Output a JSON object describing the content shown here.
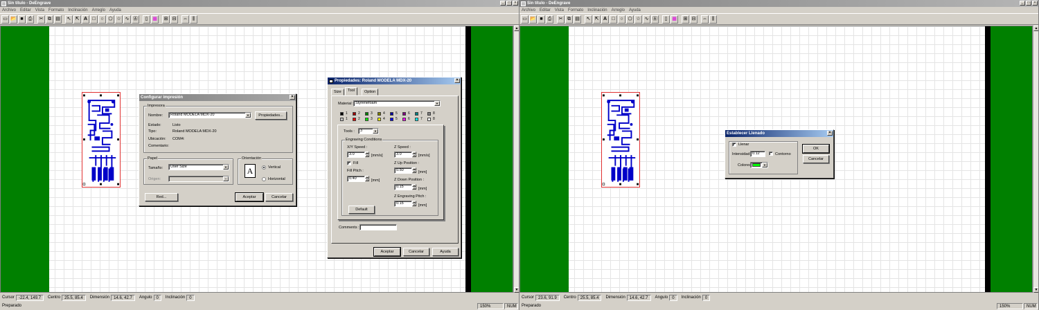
{
  "app": {
    "title": "Sin título - DeEngrave",
    "menu": [
      "Archivo",
      "Editar",
      "Vista",
      "Formato",
      "Inclinación",
      "Arreglo",
      "Ayuda"
    ],
    "toolbar_icons": [
      "new-icon",
      "open-icon",
      "save-icon",
      "print-icon",
      "cut-icon",
      "copy-icon",
      "paste-icon",
      "select-arrow-icon",
      "node-edit-icon",
      "text-tool-icon",
      "rectangle-tool-icon",
      "ellipse-tool-icon",
      "polygon-tool-icon",
      "star-tool-icon",
      "curve-tool-icon",
      "text-frame-icon",
      "fill-icon",
      "color-icon",
      "ungroup-icon",
      "group-icon",
      "size-icon",
      "align-icon"
    ],
    "window_buttons": [
      "_",
      "□",
      "×"
    ]
  },
  "left": {
    "status": {
      "cursor_label": "Cursor",
      "cursor": "-22.4, 149.7",
      "center_label": "Centro",
      "center": "25.5, 85.4",
      "dimension_label": "Dimensión",
      "dimension": "14.6, 42.7",
      "angle_label": "Angulo",
      "angle": "0",
      "inclination_label": "Inclinación",
      "inclination": "0"
    },
    "footer": {
      "ready": "Preparado",
      "zoom": "150%",
      "num": "NUM"
    }
  },
  "right": {
    "status": {
      "cursor_label": "Cursor",
      "cursor": "23.6, 91.9",
      "center_label": "Centro",
      "center": "25.5, 85.4",
      "dimension_label": "Dimensión",
      "dimension": "14.6, 42.7",
      "angle_label": "Angulo",
      "angle": "0",
      "inclination_label": "Inclinación",
      "inclination": "0"
    },
    "footer": {
      "ready": "Preparado",
      "zoom": "150%",
      "num": "NUM"
    }
  },
  "print_dialog": {
    "title": "Configurar impresión",
    "printer_group": "Impresora",
    "name_label": "Nombre:",
    "name_value": "Roland MODELA MDX-20",
    "properties_button": "Propiedades...",
    "status_label": "Estado:",
    "status_value": "Listo",
    "type_label": "Tipo:",
    "type_value": "Roland MODELA MDX-20",
    "location_label": "Ubicación:",
    "location_value": "COM4:",
    "comment_label": "Comentario:",
    "paper_group": "Papel",
    "size_label": "Tamaño:",
    "size_value": "User Size",
    "source_label": "Origen:",
    "orientation_group": "Orientación",
    "orientation_icon_letter": "A",
    "vertical_label": "Vertical",
    "horizontal_label": "Horizontal",
    "network_button": "Red...",
    "accept_button": "Aceptar",
    "cancel_button": "Cancelar"
  },
  "props_dialog": {
    "title": "Propiedades: Roland MODELA MDX-20",
    "tabs": [
      "Size",
      "Tool",
      "Option"
    ],
    "material_label": "Material :",
    "material_value": "Styrenefoam",
    "tool_numbers": [
      "1",
      "2",
      "3",
      "4",
      "5",
      "6",
      "7",
      "8"
    ],
    "tool_colors_top": [
      "#000000",
      "#a00000",
      "#008000",
      "#808000",
      "#0000a0",
      "#800080",
      "#008080",
      "#808080"
    ],
    "tool_colors_bottom": [
      "#c0c0c0",
      "#ff0000",
      "#00ff00",
      "#ffff00",
      "#0000ff",
      "#ff00ff",
      "#00ffff",
      "#ffffff"
    ],
    "tools_label": "Tools :",
    "tools_value": "3",
    "engraving_group": "Engraving Conditions",
    "xy_speed_label": "X/Y Speed :",
    "xy_speed_value": "3.0",
    "xy_speed_unit": "[mm/s]",
    "fill_label": "Fill",
    "fill_pitch_label": "Fill Pitch :",
    "fill_pitch_value": "0.40",
    "fill_pitch_unit": "[mm]",
    "z_speed_label": "Z Speed :",
    "z_speed_value": "3.0",
    "z_speed_unit": "[mm/s]",
    "z_up_label": "Z Up Position :",
    "z_up_value": "0.50",
    "z_up_unit": "[mm]",
    "z_down_label": "Z Down Position :",
    "z_down_value": "0.15",
    "z_down_unit": "[mm]",
    "z_pitch_label": "Z Engraving Pitch :",
    "z_pitch_value": "0.15",
    "z_pitch_unit": "[mm]",
    "default_button": "Default",
    "comments_label": "Comments :",
    "comments_value": "",
    "accept_button": "Aceptar",
    "cancel_button": "Cancelar",
    "help_button": "Ayuda"
  },
  "fill_dialog": {
    "title": "Establecer Llenado",
    "fill_label": "Llenar",
    "intensity_label": "Intensidad",
    "intensity_value": "0.12",
    "contour_label": "Contorno",
    "color_label": "Colores",
    "color_value": "#00ff00",
    "ok_button": "OK",
    "cancel_button": "Cancelar"
  },
  "colors": {
    "green_block": "#008000",
    "pcb_trace": "#0000c8",
    "pcb_outline": "#e03030"
  }
}
